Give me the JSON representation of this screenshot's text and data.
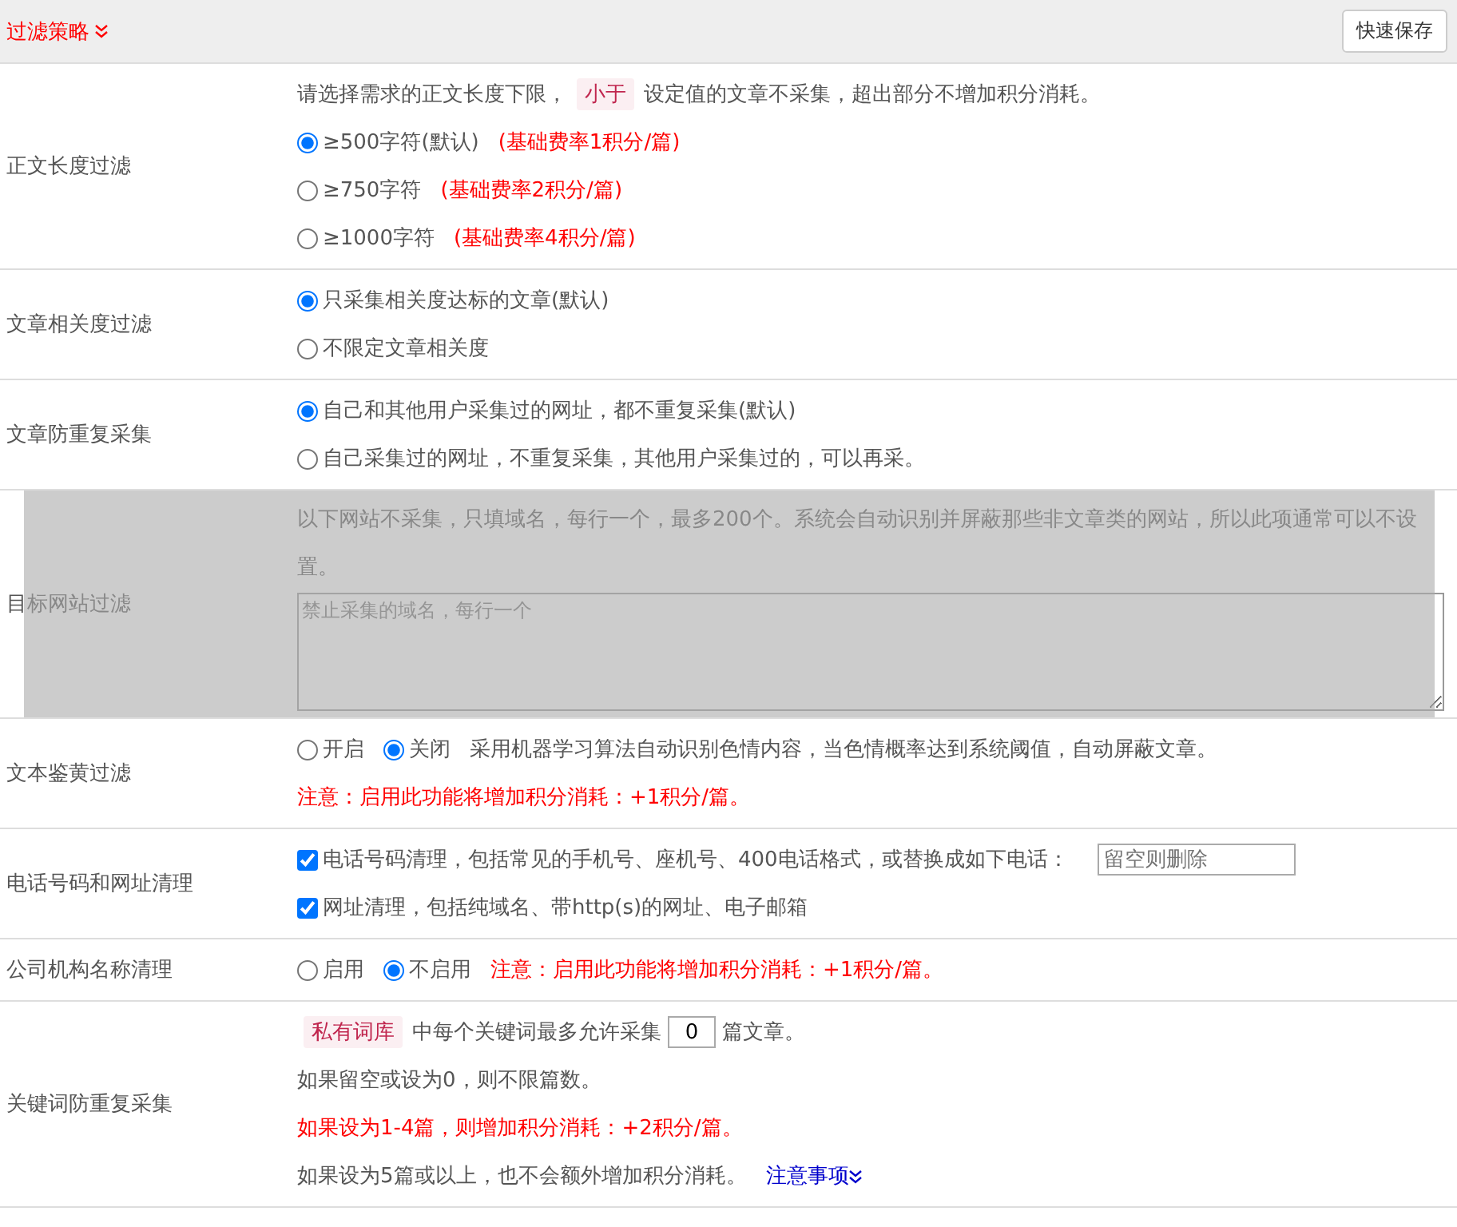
{
  "header": {
    "title": "过滤策略",
    "save_button": "快速保存"
  },
  "rows": [
    {
      "label": "正文长度过滤",
      "dimmed": false,
      "lines": [
        [
          {
            "kind": "text",
            "text": "请选择需求的正文长度下限，"
          },
          {
            "kind": "tag",
            "text": "小于"
          },
          {
            "kind": "text",
            "text": "设定值的文章不采集，超出部分不增加积分消耗。"
          }
        ],
        [
          {
            "kind": "radio",
            "text": "≥500字符(默认)",
            "checked": true
          },
          {
            "kind": "red",
            "text": "(基础费率1积分/篇)"
          }
        ],
        [
          {
            "kind": "radio",
            "text": "≥750字符",
            "checked": false
          },
          {
            "kind": "red",
            "text": "(基础费率2积分/篇)"
          }
        ],
        [
          {
            "kind": "radio",
            "text": "≥1000字符",
            "checked": false
          },
          {
            "kind": "red",
            "text": "(基础费率4积分/篇)"
          }
        ]
      ]
    },
    {
      "label": "文章相关度过滤",
      "dimmed": false,
      "lines": [
        [
          {
            "kind": "radio",
            "text": "只采集相关度达标的文章(默认)",
            "checked": true
          }
        ],
        [
          {
            "kind": "radio",
            "text": "不限定文章相关度",
            "checked": false
          }
        ]
      ]
    },
    {
      "label": "文章防重复采集",
      "dimmed": false,
      "lines": [
        [
          {
            "kind": "radio",
            "text": "自己和其他用户采集过的网址，都不重复采集(默认)",
            "checked": true
          }
        ],
        [
          {
            "kind": "radio",
            "text": "自己采集过的网址，不重复采集，其他用户采集过的，可以再采。",
            "checked": false
          }
        ]
      ]
    },
    {
      "label": "目标网站过滤",
      "dimmed": true,
      "lines": [
        [
          {
            "kind": "text",
            "text": "以下网站不采集，只填域名，每行一个，最多200个。系统会自动识别并屏蔽那些非文章类的网站，所以此项通常可以不设置。"
          }
        ],
        [
          {
            "kind": "textarea",
            "placeholder": "禁止采集的域名，每行一个"
          }
        ]
      ]
    },
    {
      "label": "文本鉴黄过滤",
      "dimmed": false,
      "lines": [
        [
          {
            "kind": "radio",
            "text": "开启",
            "checked": false
          },
          {
            "kind": "radio",
            "text": "关闭",
            "checked": true
          },
          {
            "kind": "text",
            "text": "采用机器学习算法自动识别色情内容，当色情概率达到系统阈值，自动屏蔽文章。"
          }
        ],
        [
          {
            "kind": "red",
            "text": "注意：启用此功能将增加积分消耗：+1积分/篇。"
          }
        ]
      ]
    },
    {
      "label": "电话号码和网址清理",
      "dimmed": false,
      "lines": [
        [
          {
            "kind": "checkbox",
            "text": "电话号码清理，包括常见的手机号、座机号、400电话格式，或替换成如下电话：",
            "checked": true
          },
          {
            "kind": "input",
            "placeholder": "留空则删除"
          }
        ],
        [
          {
            "kind": "checkbox",
            "text": "网址清理，包括纯域名、带http(s)的网址、电子邮箱",
            "checked": true
          }
        ]
      ]
    },
    {
      "label": "公司机构名称清理",
      "dimmed": false,
      "lines": [
        [
          {
            "kind": "radio",
            "text": "启用",
            "checked": false
          },
          {
            "kind": "radio",
            "text": "不启用",
            "checked": true
          },
          {
            "kind": "red",
            "text": "注意：启用此功能将增加积分消耗：+1积分/篇。"
          }
        ]
      ]
    },
    {
      "label": "关键词防重复采集",
      "dimmed": false,
      "lines": [
        [
          {
            "kind": "tag",
            "text": "私有词库"
          },
          {
            "kind": "text",
            "text": "中每个关键词最多允许采集"
          },
          {
            "kind": "number",
            "value": "0"
          },
          {
            "kind": "text",
            "text": "篇文章。"
          }
        ],
        [
          {
            "kind": "text",
            "text": "如果留空或设为0，则不限篇数。"
          }
        ],
        [
          {
            "kind": "red",
            "text": "如果设为1-4篇，则增加积分消耗：+2积分/篇。"
          }
        ],
        [
          {
            "kind": "text",
            "text": "如果设为5篇或以上，也不会额外增加积分消耗。"
          },
          {
            "kind": "link",
            "text": "注意事项"
          }
        ]
      ]
    }
  ]
}
